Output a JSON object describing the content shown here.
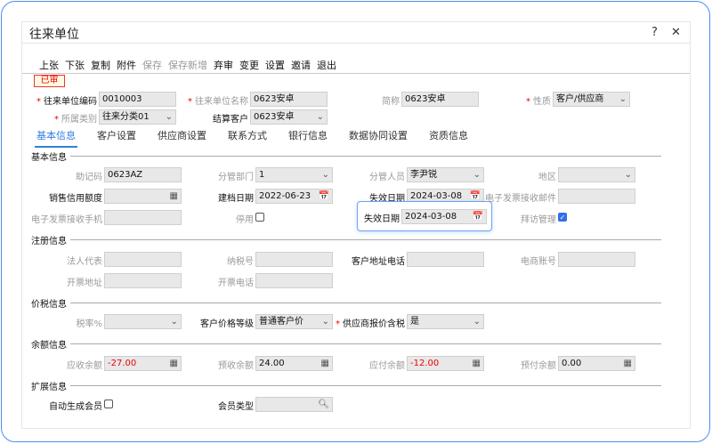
{
  "window": {
    "title": "往来单位",
    "help": "?",
    "close": "✕"
  },
  "toolbar": [
    "上张",
    "下张",
    "复制",
    "附件",
    "保存",
    "保存新增",
    "弃审",
    "变更",
    "设置",
    "邀请",
    "退出"
  ],
  "status": "已审",
  "header": {
    "code": {
      "label": "往来单位编码",
      "value": "0010003"
    },
    "name": {
      "label": "往来单位名称",
      "value": "0623安卓"
    },
    "short": {
      "label": "简称",
      "value": "0623安卓"
    },
    "nature": {
      "label": "性质",
      "value": "客户/供应商"
    },
    "category": {
      "label": "所属类别",
      "value": "往来分类01"
    },
    "settle": {
      "label": "结算客户",
      "value": "0623安卓"
    }
  },
  "tabs": [
    "基本信息",
    "客户设置",
    "供应商设置",
    "联系方式",
    "银行信息",
    "数据协同设置",
    "资质信息"
  ],
  "basic": {
    "title": "基本信息",
    "mnemonic": {
      "label": "助记码",
      "value": "0623AZ"
    },
    "dept": {
      "label": "分管部门",
      "value": "1"
    },
    "staff": {
      "label": "分管人员",
      "value": "李尹锐"
    },
    "region": {
      "label": "地区",
      "value": ""
    },
    "credit": {
      "label": "销售信用额度",
      "value": ""
    },
    "created": {
      "label": "建档日期",
      "value": "2022-06-23"
    },
    "expire": {
      "label": "失效日期",
      "value": "2024-03-08"
    },
    "email": {
      "label": "电子发票接收邮件",
      "value": ""
    },
    "phone": {
      "label": "电子发票接收手机",
      "value": ""
    },
    "disabled": {
      "label": "停用"
    },
    "visit": {
      "label": "拜访管理"
    }
  },
  "register": {
    "title": "注册信息",
    "legal": {
      "label": "法人代表",
      "value": ""
    },
    "tax_no": {
      "label": "纳税号",
      "value": ""
    },
    "addr_phone": {
      "label": "客户地址电话",
      "value": ""
    },
    "ecom": {
      "label": "电商账号",
      "value": ""
    },
    "inv_addr": {
      "label": "开票地址",
      "value": ""
    },
    "inv_phone": {
      "label": "开票电话",
      "value": ""
    }
  },
  "tax": {
    "title": "价税信息",
    "rate": {
      "label": "税率%",
      "value": ""
    },
    "price_level": {
      "label": "客户价格等级",
      "value": "普通客户价"
    },
    "incl_tax": {
      "label": "供应商报价含税",
      "value": "是"
    }
  },
  "balance": {
    "title": "余额信息",
    "receivable": {
      "label": "应收余额",
      "value": "-27.00"
    },
    "prereceived": {
      "label": "预收余额",
      "value": "24.00"
    },
    "payable": {
      "label": "应付余额",
      "value": "-12.00"
    },
    "prepaid": {
      "label": "预付余额",
      "value": "0.00"
    }
  },
  "ext": {
    "title": "扩展信息",
    "auto_member": {
      "label": "自动生成会员"
    },
    "member_type": {
      "label": "会员类型",
      "value": ""
    }
  },
  "callout": {
    "label": "失效日期",
    "value": "2024-03-08"
  }
}
